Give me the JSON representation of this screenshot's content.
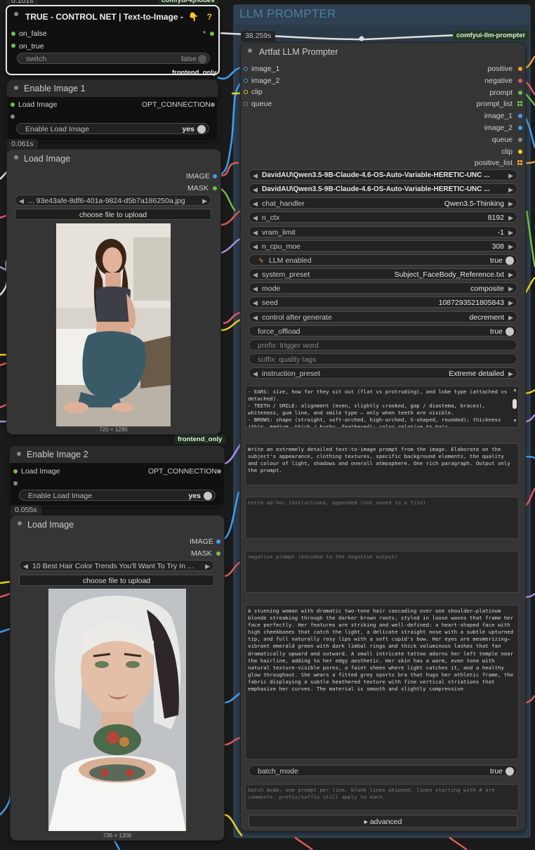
{
  "wires_label": "comfyui-kjnodes",
  "timings": {
    "switch_node": "0.101s",
    "load_image_1": "0.061s",
    "load_image_2": "0.055s",
    "llm": "38.259s"
  },
  "tags": {
    "kjnodes": "comfyui-kjnodes",
    "llm_prompter": "comfyui-llm-prompter",
    "frontend_only_1": "frontend_only",
    "frontend_only_2": "frontend_only"
  },
  "switch_node": {
    "title": "TRUE - CONTROL NET | Text-to-Image -",
    "emoji": "👇",
    "help": "?",
    "inputs": [
      "on_false",
      "on_true"
    ],
    "output_star": "*",
    "widget_label": "switch",
    "widget_value": "false"
  },
  "enable_image_1": {
    "title": "Enable Image 1",
    "input": "Load Image",
    "output": "OPT_CONNECTION",
    "widget_label": "Enable Load Image",
    "widget_value": "yes"
  },
  "load_image_1": {
    "title": "Load Image",
    "outputs": [
      "IMAGE",
      "MASK"
    ],
    "filename": "... 93e43afe-8df6-401a-9824-d5b7a186250a.jpg",
    "upload_label": "choose file to upload",
    "dims": "720 × 1280"
  },
  "enable_image_2": {
    "title": "Enable Image 2",
    "input": "Load Image",
    "output": "OPT_CONNECTION",
    "widget_label": "Enable Load Image",
    "widget_value": "yes"
  },
  "load_image_2": {
    "title": "Load Image",
    "outputs": [
      "IMAGE",
      "MASK"
    ],
    "filename": "10 Best Hair Color Trends You'll Want To Try In ...",
    "upload_label": "choose file to upload",
    "dims": "736 × 1308"
  },
  "group": {
    "title": "LLM PROMPTER"
  },
  "llm_node": {
    "title": "Artfat LLM Prompter",
    "inputs": [
      "image_1",
      "image_2",
      "clip",
      "queue"
    ],
    "outputs": [
      "positive",
      "negative",
      "prompt",
      "prompt_list",
      "image_1",
      "image_2",
      "queue",
      "clip",
      "positive_list"
    ],
    "widgets": [
      {
        "label": "DavidAU\\Qwen3.5-9B-Claude-4.6-OS-Auto-Variable-HERETIC-UNC ...",
        "value": "",
        "kind": "combo_bold"
      },
      {
        "label": "DavidAU\\Qwen3.5-9B-Claude-4.6-OS-Auto-Variable-HERETIC-UNC ...",
        "value": "",
        "kind": "combo_bold"
      },
      {
        "label": "chat_handler",
        "value": "Qwen3.5-Thinking",
        "kind": "combo"
      },
      {
        "label": "n_ctx",
        "value": "8192",
        "kind": "num"
      },
      {
        "label": "vram_limit",
        "value": "-1",
        "kind": "num"
      },
      {
        "label": "n_cpu_moe",
        "value": "308",
        "kind": "num"
      },
      {
        "label": "LLM enabled",
        "value": "true",
        "kind": "toggle_bolt"
      },
      {
        "label": "system_preset",
        "value": "Subject_FaceBody_Reference.txt",
        "kind": "combo"
      },
      {
        "label": "mode",
        "value": "composite",
        "kind": "combo"
      },
      {
        "label": "seed",
        "value": "1087293521805843",
        "kind": "num"
      },
      {
        "label": "control after generate",
        "value": "decrement",
        "kind": "combo"
      },
      {
        "label": "force_offload",
        "value": "true",
        "kind": "toggle"
      },
      {
        "label": "prefix: trigger word",
        "value": "",
        "kind": "text"
      },
      {
        "label": "suffix: quality tags",
        "value": "",
        "kind": "text"
      },
      {
        "label": "instruction_preset",
        "value": "Extreme detailed",
        "kind": "combo"
      }
    ],
    "preset_text": "- EARS: size, how far they sit out (flat vs protruding), and lobe type (attached vs detached).\n- TEETH / SMILE: alignment (even, slightly crooked, gap / diastema, braces), whiteness, gum line, and smile type — only when teeth are visible.\n- BROWS: shape (straight, soft-arched, high-arched, S-shaped, rounded); thickness (thin, medium, thick / bushy, feathered); color relative to hair.",
    "instruction_text": "Write an extremely detailed text-to-image prompt from the image. Elaborate on the subject's appearance, clothing textures, specific background elements, the quality and colour of light, shadows and overall atmosphere. One rich paragraph. Output only the prompt.",
    "adhoc_placeholder": "extra ad-hoc instructions, appended (not saved to a file)",
    "negative_placeholder": "negative prompt (encoded to the negative output)",
    "output_text": "A stunning woman with dramatic two-tone hair cascading over one shoulder—platinum blonde streaking through the darker brown roots, styled in loose waves that frame her face perfectly. Her features are striking and well-defined: a heart-shaped face with high cheekbones that catch the light, a delicate straight nose with a subtle upturned tip, and full naturally rosy lips with a soft cupid's bow. Her eyes are mesmerizing—vibrant emerald green with dark limbal rings and thick voluminous lashes that fan dramatically upward and outward. A small intricate tattoo adorns her left temple near the hairline, adding to her edgy aesthetic. Her skin has a warm, even tone with natural texture-visible pores, a faint sheen where light catches it, and a healthy glow throughout. She wears a fitted grey sports bra that hugs her athletic frame, the fabric displaying a subtle heathered texture with fine vertical striations that emphasize her curves. The material is smooth and slightly compressive",
    "batch_label": "batch_mode",
    "batch_value": "true",
    "batch_placeholder": "batch mode: one prompt per line. blank lines skipped, lines starting with # are comments. prefix/suffix still apply to each.",
    "advanced_label": "▸ advanced"
  },
  "colors": {
    "canvas": "#1a1a1a",
    "node": "#353535",
    "group": "#2b3a48",
    "group_title": "#4f7ea3",
    "wire_blue": "#3ea0f0",
    "wire_red": "#e05a5a",
    "wire_yellow": "#e8d020",
    "wire_green": "#6cc04a",
    "wire_purple": "#a890e0",
    "wire_white": "#e0e0e0",
    "wire_orange": "#f0a030"
  }
}
